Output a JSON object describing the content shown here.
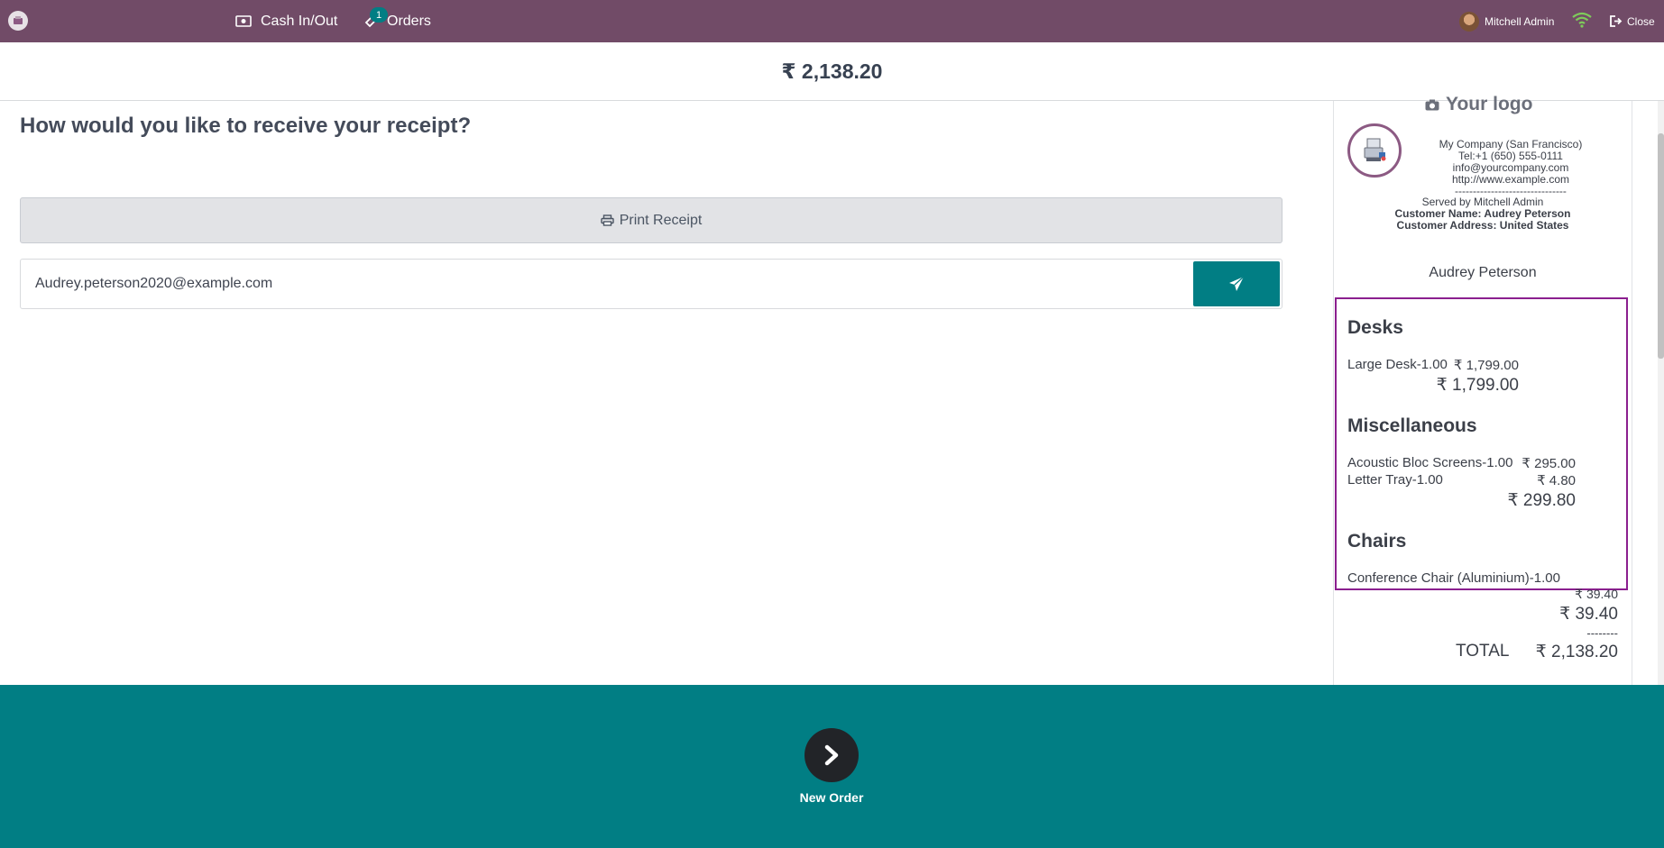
{
  "navbar": {
    "cash_label": "Cash In/Out",
    "orders_label": "Orders",
    "orders_badge": "1",
    "user_name": "Mitchell Admin",
    "close_label": "Close",
    "brand_color": "#714b67"
  },
  "payment": {
    "total": "₹ 2,138.20"
  },
  "receipt_options": {
    "question": "How would you like to receive your receipt?",
    "print_label": "Print Receipt",
    "email_value": "Audrey.peterson2020@example.com"
  },
  "receipt": {
    "logo_text": "Your logo",
    "company_name": "My Company (San Francisco)",
    "tel": "Tel:+1 (650) 555-0111",
    "email": "info@yourcompany.com",
    "website": "http://www.example.com",
    "separator": "-------------------------------",
    "served_by": "Served by Mitchell Admin",
    "customer_name_line": "Customer Name: Audrey Peterson",
    "customer_address_line": "Customer Address: United States",
    "customer_name": "Audrey Peterson",
    "categories": [
      {
        "name": "Desks",
        "lines": [
          {
            "label": "Large Desk-1.00",
            "amount": "₹ 1,799.00"
          }
        ],
        "subtotal": "₹ 1,799.00"
      },
      {
        "name": "Miscellaneous",
        "lines": [
          {
            "label": "Acoustic Bloc Screens-1.00",
            "amount": "₹ 295.00"
          },
          {
            "label": "Letter Tray-1.00",
            "amount": "₹ 4.80"
          }
        ],
        "subtotal": "₹ 299.80"
      },
      {
        "name": "Chairs",
        "lines": [
          {
            "label": "Conference Chair (Aluminium)-1.00",
            "amount": "₹ 39.40"
          }
        ],
        "subtotal": "₹ 39.40"
      }
    ],
    "dash_line": "--------",
    "total_label": "TOTAL",
    "total_value": "₹ 2,138.20"
  },
  "footer": {
    "next_label": "New Order",
    "color": "#017e84"
  }
}
